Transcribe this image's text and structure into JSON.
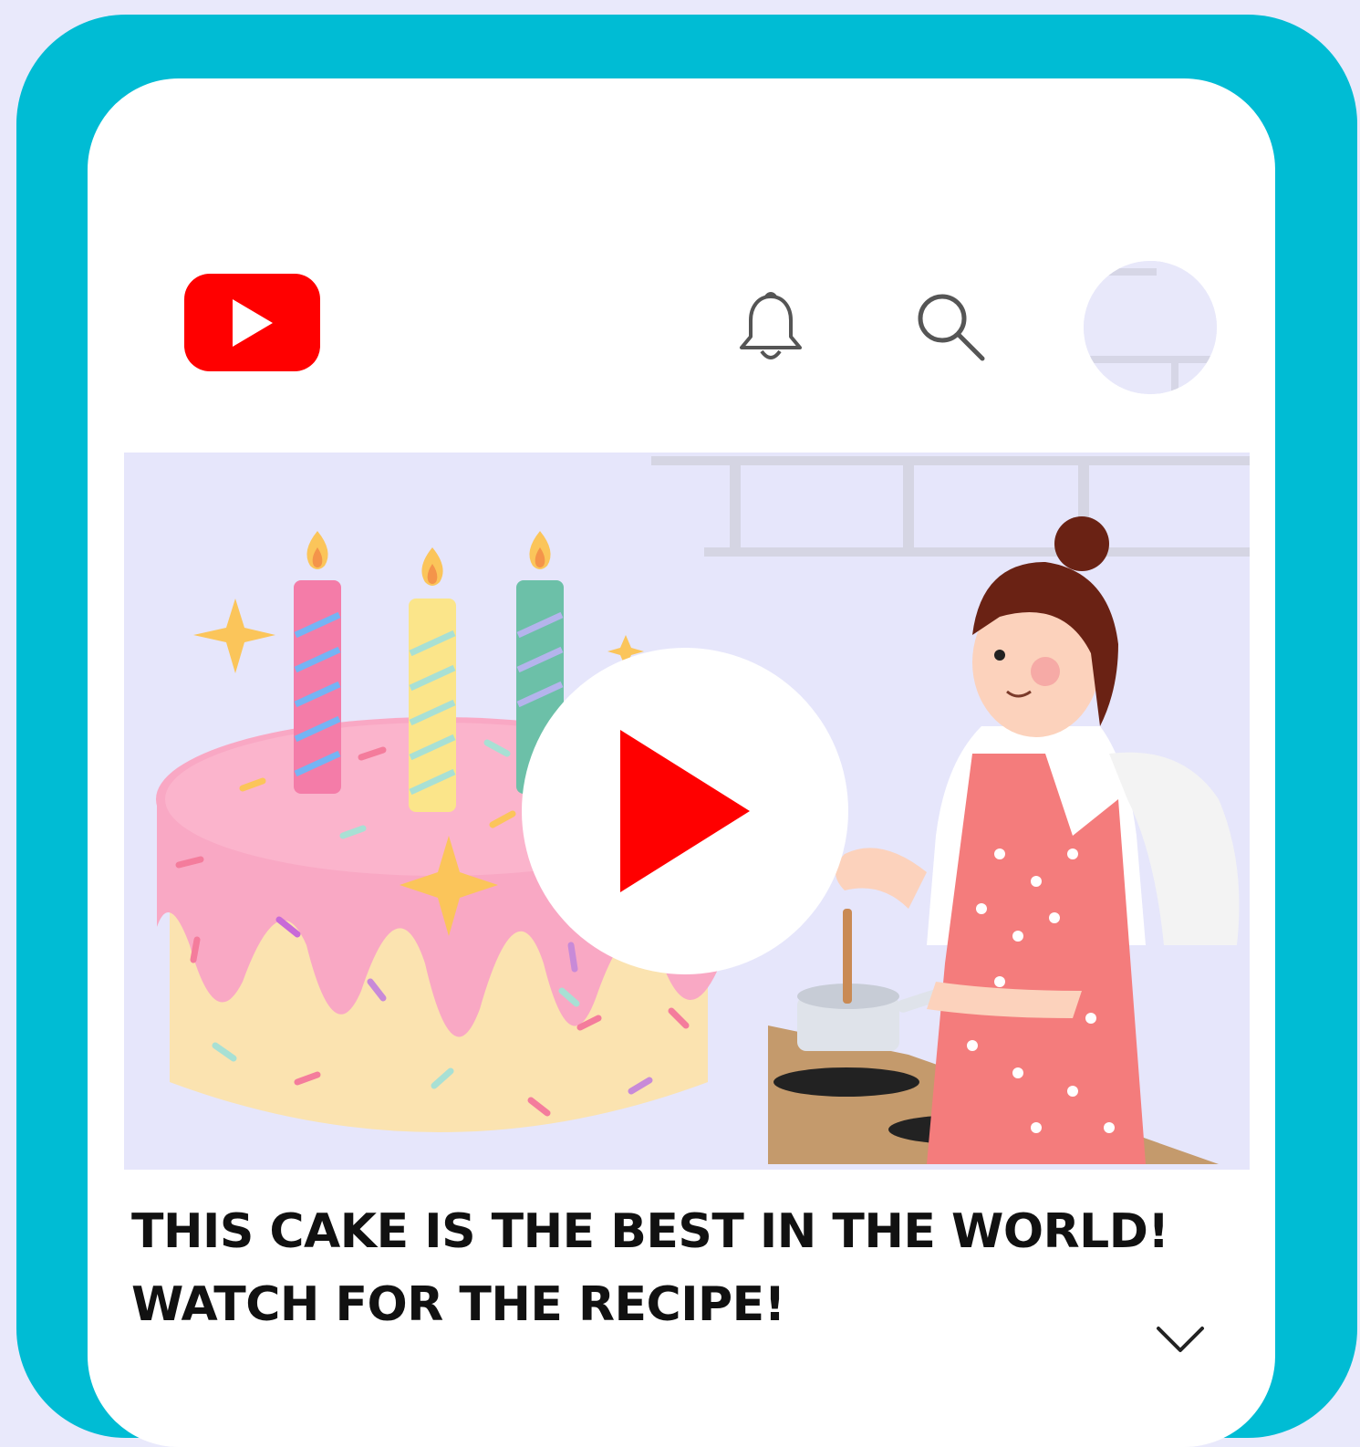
{
  "header": {
    "logo_icon": "play-button-icon",
    "notifications_icon": "bell-icon",
    "search_icon": "search-icon",
    "avatar_icon": "avatar"
  },
  "video": {
    "title_line1": "THIS CAKE IS THE BEST IN THE WORLD!",
    "title_line2": "WATCH FOR THE RECIPE!",
    "play_icon": "play-icon",
    "expand_icon": "chevron-down-icon"
  },
  "colors": {
    "frame": "#00bcd4",
    "brand_red": "#ff0000",
    "background": "#e9e9fb",
    "cake_frosting": "#f9a8c4",
    "cake_base": "#fbe3b0",
    "apron": "#f47c7c"
  }
}
